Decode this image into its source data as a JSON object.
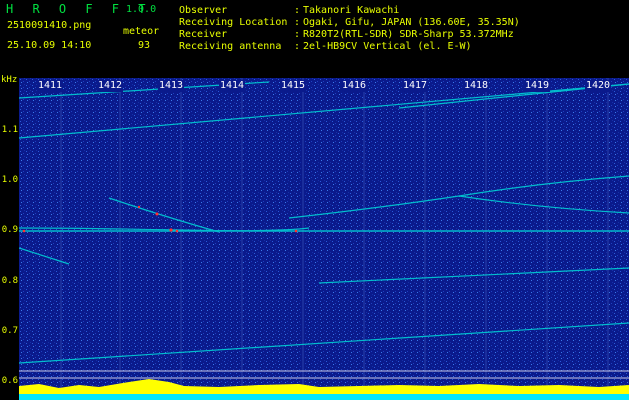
{
  "header": {
    "brand": "H R O F F T",
    "version": "1.0.0",
    "filename": "2510091410.png",
    "timestamp": "25.10.09 14:10",
    "meteor_label": "meteor",
    "meteor_count": "93",
    "rows": [
      {
        "label": "Observer",
        "value": "Takanori Kawachi"
      },
      {
        "label": "Receiving Location",
        "value": "Ogaki, Gifu, JAPAN (136.60E, 35.35N)"
      },
      {
        "label": "Receiver",
        "value": "R820T2(RTL-SDR) SDR-Sharp 53.372MHz"
      },
      {
        "label": "Receiving antenna",
        "value": "2el-HB9CV Vertical (el. E-W)"
      }
    ]
  },
  "axis": {
    "unit": "kHz",
    "y_ticks": [
      "1.1",
      "1.0",
      "0.9",
      "0.8",
      "0.7",
      "0.6"
    ],
    "minute_labels": [
      "1411",
      "1412",
      "1413",
      "1414",
      "1415",
      "1416",
      "1417",
      "1418",
      "1419",
      "1420"
    ]
  },
  "colors": {
    "background": "#000000",
    "text_yellow": "#e8ff00",
    "brand_green": "#00e040",
    "spectrum_bg": "#0a1a8c",
    "signal": "#00e0e0",
    "hot": "#ff3030",
    "baseline": "#ffff00"
  }
}
